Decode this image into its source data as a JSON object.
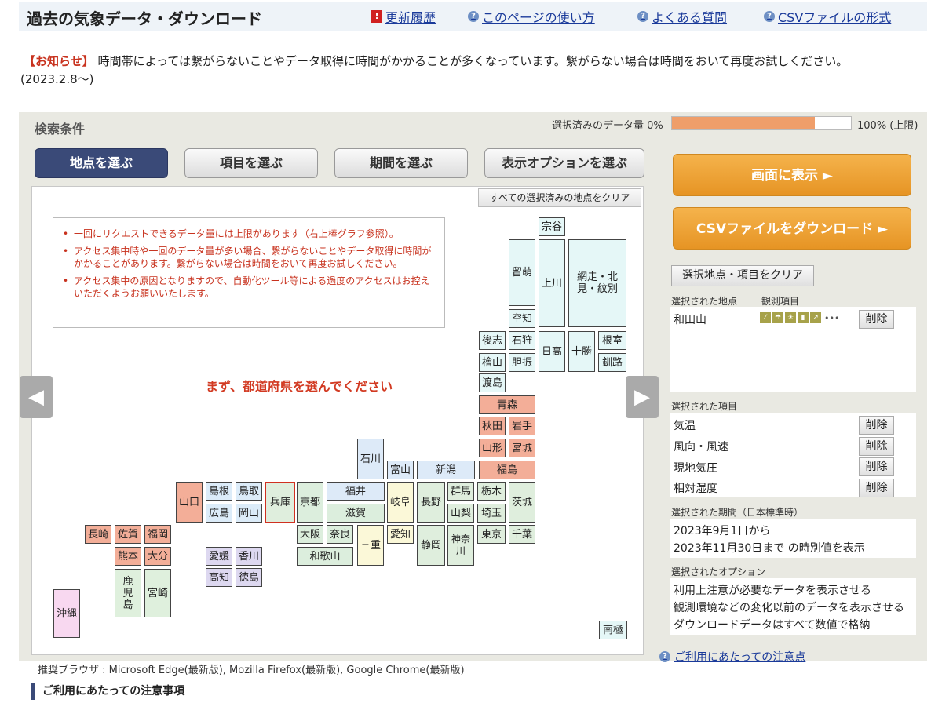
{
  "header": {
    "title": "過去の気象データ・ダウンロード",
    "links": [
      "更新履歴",
      "このページの使い方",
      "よくある質問",
      "CSVファイルの形式"
    ]
  },
  "notice": {
    "label": "【お知らせ】",
    "text": "時間帯によっては繋がらないことやデータ取得に時間がかかることが多くなっています。繋がらない場合は時間をおいて再度お試しください。",
    "date": "(2023.2.8〜)"
  },
  "search": {
    "title": "検索条件",
    "data_amount_label": "選択済みのデータ量 0%",
    "data_amount_max": "100% (上限)",
    "data_amount_fraction": 0.8,
    "tabs": [
      "地点を選ぶ",
      "項目を選ぶ",
      "期間を選ぶ",
      "表示オプションを選ぶ"
    ],
    "clear_all": "すべての選択済みの地点をクリア",
    "notes": [
      "一回にリクエストできるデータ量には上限があります（右上棒グラフ参照）。",
      "アクセス集中時や一回のデータ量が多い場合、繋がらないことやデータ取得に時間がかかることがあります。繋がらない場合は時間をおいて再度お試しください。",
      "アクセス集中の原因となりますので、自動化ツール等による過度のアクセスはお控えいただくようお願いいたします。"
    ],
    "choose_message": "まず、都道府県を選んでください",
    "prev_arrow": "◀",
    "next_arrow": "▶"
  },
  "prefectures": {
    "soya": "宗谷",
    "rumoi": "留萌",
    "kamikawa": "上川",
    "abashiri": "網走・北見・紋別",
    "sorachi": "空知",
    "shiribeshi": "後志",
    "ishikari": "石狩",
    "nemuro": "根室",
    "hidaka": "日高",
    "tokachi": "十勝",
    "hiyama": "檜山",
    "iburi": "胆振",
    "kushiro": "釧路",
    "oshima": "渡島",
    "aomori": "青森",
    "akita": "秋田",
    "iwate": "岩手",
    "yamagata": "山形",
    "miyagi": "宮城",
    "fukushima": "福島",
    "ishikawa": "石川",
    "toyama": "富山",
    "niigata": "新潟",
    "shimane": "島根",
    "tottori": "鳥取",
    "hyogo": "兵庫",
    "kyoto": "京都",
    "fukui": "福井",
    "gifu": "岐阜",
    "nagano": "長野",
    "gunma": "群馬",
    "tochigi": "栃木",
    "ibaraki": "茨城",
    "yamaguchi": "山口",
    "hiroshima": "広島",
    "okayama": "岡山",
    "shiga": "滋賀",
    "yamanashi": "山梨",
    "saitama": "埼玉",
    "nagasaki": "長崎",
    "saga": "佐賀",
    "fukuoka": "福岡",
    "osaka": "大阪",
    "nara": "奈良",
    "mie": "三重",
    "aichi": "愛知",
    "shizuoka": "静岡",
    "kanagawa": "神奈川",
    "tokyo": "東京",
    "chiba": "千葉",
    "kumamoto": "熊本",
    "oita": "大分",
    "ehime": "愛媛",
    "kagawa": "香川",
    "wakayama": "和歌山",
    "kochi": "高知",
    "tokushima": "徳島",
    "kagoshima": "鹿児島",
    "miyazaki": "宮崎",
    "okinawa": "沖縄",
    "nankyoku": "南極"
  },
  "sidebar": {
    "display_button": "画面に表示 ►",
    "csv_button": "CSVファイルをダウンロード ►",
    "clear_selection": "選択地点・項目をクリア",
    "selected_points_label": "選択された地点",
    "obs_items_label": "観測項目",
    "point_name": "和田山",
    "obs_icons": [
      "rain-icon",
      "umbrella-icon",
      "sun-icon",
      "thermometer-icon",
      "wind-icon"
    ],
    "obs_more": "•••",
    "delete": "削除",
    "selected_items_label": "選択された項目",
    "items": [
      "気温",
      "風向・風速",
      "現地気圧",
      "相対湿度"
    ],
    "period_label": "選択された期間（日本標準時）",
    "period_from": "2023年9月1日から",
    "period_to": "2023年11月30日まで の時別値を表示",
    "options_label": "選択されたオプション",
    "options": [
      "利用上注意が必要なデータを表示させる",
      "観測環境などの変化以前のデータを表示させる",
      "ダウンロードデータはすべて数値で格納"
    ],
    "usage_link": "ご利用にあたっての注意点"
  },
  "footer": {
    "browser_note": "推奨ブラウザ : Microsoft Edge(最新版), Mozilla Firefox(最新版), Google Chrome(最新版)",
    "caution_heading": "ご利用にあたっての注意事項"
  }
}
